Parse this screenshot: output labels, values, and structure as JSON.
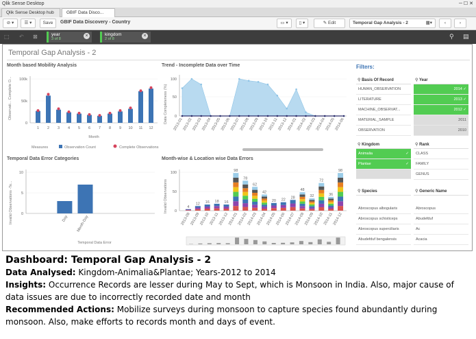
{
  "window": {
    "title": "Qlik Sense Desktop"
  },
  "tabs": [
    {
      "label": "Qlik Sense Desktop hub"
    },
    {
      "label": "GBIF Data Disco..."
    }
  ],
  "toolbar": {
    "save": "Save",
    "app_name": "GBIF Data Discovery - Country",
    "edit": "Edit",
    "sheet_name": "Temporal Gap Analysis - 2"
  },
  "selections": [
    {
      "field": "year",
      "count": "3 of 8"
    },
    {
      "field": "kingdom",
      "count": "2 of 8"
    }
  ],
  "sheet": {
    "title": "Temporal Gap Analysis - 2"
  },
  "panels": {
    "p1": "Month based Mobility Analysis",
    "p2": "Trend - Incomplete Data over Time",
    "p3": "Temporal Data Error Categories",
    "p4": "Month-wise & Location wise Data Errors"
  },
  "chart_data": [
    {
      "type": "bar",
      "title": "Month based Mobility Analysis",
      "categories": [
        "1",
        "2",
        "3",
        "4",
        "5",
        "6",
        "7",
        "8",
        "9",
        "10",
        "11",
        "12"
      ],
      "series": [
        {
          "name": "Observation Count",
          "values": [
            27000,
            62000,
            30000,
            24000,
            21000,
            18000,
            16000,
            21000,
            26000,
            32000,
            72000,
            78000
          ]
        },
        {
          "name": "Complete Observations",
          "values": [
            28000,
            65000,
            32000,
            25000,
            22000,
            19000,
            17000,
            22000,
            28000,
            34000,
            73000,
            80000
          ]
        }
      ],
      "xlabel": "Month",
      "ylabel": "Observati... Complete O...",
      "yticks": [
        "0",
        "50k",
        "100k"
      ],
      "ylim": [
        0,
        100000
      ],
      "legend_title": "Measures",
      "colors": {
        "bar": "#3d74b4",
        "dot": "#d6445c"
      }
    },
    {
      "type": "area",
      "title": "Trend - Incomplete Data over Time",
      "categories": [
        "2013-01",
        "2013-02",
        "2013-03",
        "2013-04",
        "2013-05",
        "2013-06",
        "2013-07",
        "2013-08",
        "2013-09",
        "2013-10",
        "2013-11",
        "2013-12",
        "2014-01",
        "2014-02",
        "2014-03",
        "2014-04",
        "2014-05",
        "2014-06"
      ],
      "values": [
        75,
        100,
        85,
        0,
        0,
        0,
        100,
        95,
        92,
        85,
        55,
        20,
        72,
        10,
        0,
        0,
        0,
        0
      ],
      "baseline_values": [
        0,
        0,
        0,
        0,
        0,
        0,
        0,
        0,
        0,
        0,
        0,
        0,
        0,
        0,
        0,
        0,
        0,
        0
      ],
      "ylabel": "Data Completeness (%)",
      "yticks": [
        "0",
        "50",
        "100"
      ],
      "ylim": [
        0,
        100
      ],
      "colors": {
        "area": "#b8daf0",
        "line": "#8fc4e6",
        "base": "#2d2d6b"
      }
    },
    {
      "type": "bar",
      "title": "Temporal Data Error Categories",
      "categories": [
        "Day",
        "Month-Day"
      ],
      "values": [
        3,
        7
      ],
      "xlabel": "Temporal Data Error",
      "ylabel": "Invalid Observations -Te...",
      "yticks": [
        "0",
        "5",
        "10"
      ],
      "ylim": [
        0,
        10
      ],
      "colors": {
        "bar": "#3d74b4"
      }
    },
    {
      "type": "bar",
      "title": "Month-wise & Location wise Data Errors",
      "categories": [
        "2013-08",
        "2013-09",
        "2013-10",
        "2013-11",
        "2013-12",
        "2014-01",
        "2014-02",
        "2014-03",
        "2014-04",
        "2014-05",
        "2014-06",
        "2014-07",
        "2014-08",
        "2014-09",
        "2014-10",
        "2014-11",
        "2014-12"
      ],
      "values": [
        4,
        12,
        16,
        18,
        16,
        98,
        78,
        62,
        42,
        20,
        22,
        28,
        48,
        32,
        72,
        36,
        98
      ],
      "ylabel": "Invalid Observations",
      "yticks": [
        "0",
        "50",
        "100"
      ],
      "ylim": [
        0,
        100
      ],
      "colors": {
        "stack": [
          "#d9534f",
          "#8e44ad",
          "#3d74b4",
          "#52cc52",
          "#f0c419",
          "#e67e22",
          "#555555",
          "#9bcce8"
        ]
      }
    }
  ],
  "filters": {
    "title": "Filters:",
    "basis": {
      "title": "Basis Of Record",
      "items": [
        "HUMAN_OBSERVATION",
        "LITERATURE",
        "MACHINE_OBSERVAT...",
        "MATERIAL_SAMPLE",
        "OBSERVATION"
      ]
    },
    "year": {
      "title": "Year",
      "items": [
        {
          "label": "2014",
          "state": "selected"
        },
        {
          "label": "2013",
          "state": "selected"
        },
        {
          "label": "2012",
          "state": "selected"
        },
        {
          "label": "2011",
          "state": "excluded"
        },
        {
          "label": "2010",
          "state": "excluded"
        }
      ]
    },
    "kingdom": {
      "title": "Kingdom",
      "items": [
        {
          "label": "Animalia",
          "state": "selected"
        },
        {
          "label": "Plantae",
          "state": "selected"
        }
      ]
    },
    "rank": {
      "title": "Rank",
      "items": [
        "CLASS",
        "FAMILY",
        "GENUS"
      ]
    },
    "species": {
      "title": "Species",
      "items": [
        "Abroscopus albogularis",
        "Abroscopus schisticeps",
        "Abroscopus superciliaris",
        "Abudefduf bengalensis"
      ]
    },
    "generic": {
      "title": "Generic Name",
      "items": [
        "Abroscopus",
        "Abudefduf",
        "Ac",
        "Acacia"
      ]
    }
  },
  "caption": {
    "heading": "Dashboard: Temporal Gap Analysis - 2",
    "data_label": "Data Analysed:",
    "data_text": " Kingdom-Animalia&Plantae; Years-2012 to 2014",
    "insights_label": "Insights:",
    "insights_text": " Occurrence Records are lesser during May to Sept, which is Monsoon in India. Also, major cause of data issues are due to incorrectly recorded date and month",
    "actions_label": "Recommended Actions:",
    "actions_text": " Mobilize surveys during monsoon to capture species found abundantly during monsoon. Also, make efforts to records month and days of event."
  }
}
